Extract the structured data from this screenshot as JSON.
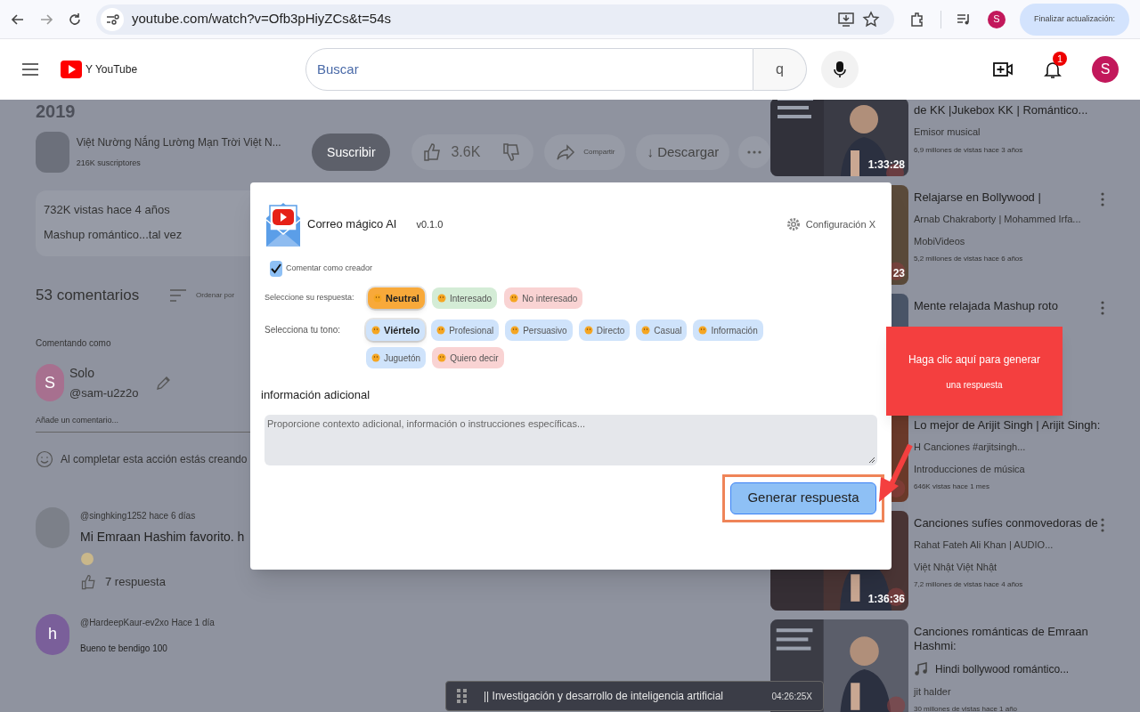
{
  "browser": {
    "url": "youtube.com/watch?v=Ofb3pHiyZCs&t=54s",
    "profile_initial": "S",
    "update_button": "Finalizar actualización:"
  },
  "header": {
    "logo_text": "Y YouTube",
    "search_placeholder": "Buscar",
    "search_button": "q",
    "notification_count": "1",
    "avatar_initial": "S"
  },
  "video": {
    "year": "2019",
    "channel_name": "Việt Nường Nắng Lường Mạn Trời Việt N...",
    "subscribers": "216K suscriptores",
    "subscribe": "Suscribir",
    "likes": "3.6K",
    "share": "Compartir",
    "download": "↓ Descargar",
    "stats": "732K vistas hace 4 años",
    "description": "Mashup romántico...tal vez"
  },
  "comments": {
    "count": "53 comentarios",
    "sort": "Ordenar por",
    "commenting_as": "Comentando como",
    "user": {
      "initial": "S",
      "name": "Solo",
      "handle": "@sam-u2z2o"
    },
    "add_placeholder": "Añade un comentario...",
    "notice": "Al completar esta acción estás creando",
    "items": [
      {
        "author": "@singhking1252 hace 6 días",
        "text": "Mi Emraan Hashim favorito. h",
        "replies": "7 respuesta"
      },
      {
        "initial": "h",
        "author": "@HardeepKaur-ev2xo Hace 1 día",
        "text": "Bueno te bendigo 100"
      }
    ]
  },
  "related": [
    {
      "title": "de KK |Jukebox KK | Romántico...",
      "channel": "Emisor musical",
      "meta": "6,9 millones de vistas hace 3 años",
      "duration": "1:33:28"
    },
    {
      "title": "Relajarse en Bollywood |",
      "subtitle": "Arnab Chakraborty | Mohammed Irfa...",
      "channel": "MobiVideos",
      "meta": "5,2 millones de vistas hace 6 años",
      "duration": "23"
    },
    {
      "title": "Mente relajada Mashup roto"
    },
    {
      "title": "Lo mejor de Arijit Singh | Arijit Singh:",
      "subtitle": "H Canciones #arjitsingh...",
      "channel": "Introducciones de música",
      "meta": "646K vistas hace 1 mes"
    },
    {
      "title": "Canciones sufíes conmovedoras de",
      "subtitle": "Rahat Fateh Ali Khan | AUDIO...",
      "channel": "Việt Nhật Việt Nhật",
      "meta": "7,2 millones de vistas hace 4 años",
      "duration": "1:36:36"
    },
    {
      "title": "Canciones románticas de Emraan Hashmi:",
      "subtitle": "Hindi bollywood romántico...",
      "music_note": true,
      "channel": "jit halder",
      "meta": "30 millones de vistas hace 1 año"
    }
  ],
  "extension": {
    "title": "Correo mágico AI",
    "version": "v0.1.0",
    "settings": "Configuración X",
    "comment_as_creator": {
      "label": "Comentar como creador",
      "checked": true
    },
    "response_label": "Seleccione su respuesta:",
    "responses": [
      {
        "label": "Neutral",
        "selected": true,
        "color": "#f8a93a"
      },
      {
        "label": "Interesado",
        "selected": false,
        "color": "#d4ecd6"
      },
      {
        "label": "No interesado",
        "selected": false,
        "color": "#f9d3d3"
      }
    ],
    "tone_label": "Selecciona tu tono:",
    "tones": [
      {
        "label": "Viértelo",
        "selected": true,
        "color": "#cfe3fb"
      },
      {
        "label": "Profesional",
        "selected": false,
        "color": "#cfe3fb"
      },
      {
        "label": "Persuasivo",
        "selected": false,
        "color": "#cfe3fb"
      },
      {
        "label": "Directo",
        "selected": false,
        "color": "#cfe3fb"
      },
      {
        "label": "Casual",
        "selected": false,
        "color": "#cfe3fb"
      },
      {
        "label": "Información",
        "selected": false,
        "color": "#cfe3fb"
      },
      {
        "label": "Juguetón",
        "selected": false,
        "color": "#cfe3fb"
      },
      {
        "label": "Quiero decir",
        "selected": false,
        "color": "#f9d3d3"
      }
    ],
    "additional_label": "información adicional",
    "additional_placeholder": "Proporcione contexto adicional, información o instrucciones específicas...",
    "generate": "Generar respuesta"
  },
  "callout": {
    "line1": "Haga clic aquí para generar",
    "line2": "una respuesta"
  },
  "player_bar": {
    "title": "|| Investigación y desarrollo de inteligencia artificial",
    "time": "04:26:25X"
  }
}
